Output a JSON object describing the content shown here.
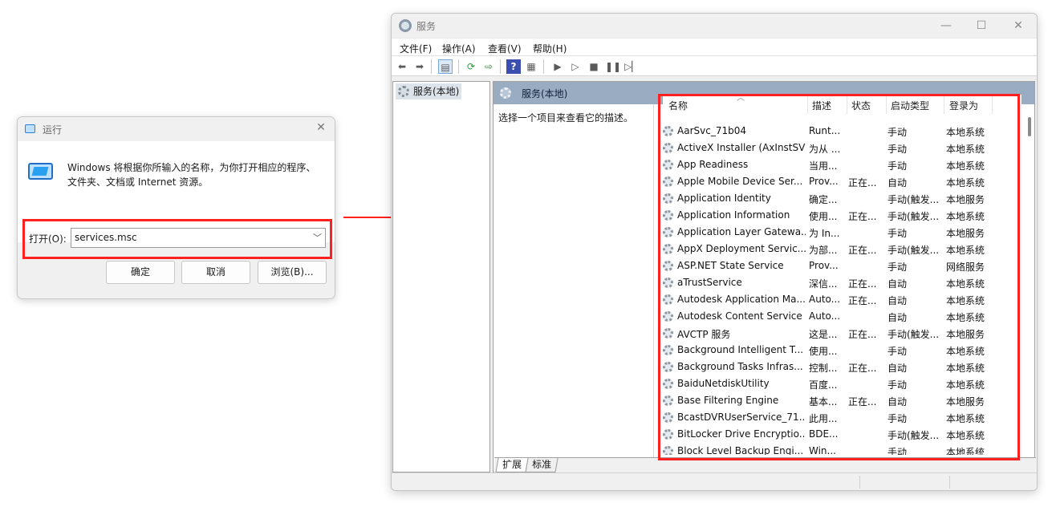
{
  "run_dialog": {
    "title": "运行",
    "description": "Windows 将根据你所输入的名称，为你打开相应的程序、文件夹、文档或 Internet 资源。",
    "open_label": "打开(O):",
    "open_value": "services.msc",
    "ok_label": "确定",
    "cancel_label": "取消",
    "browse_label": "浏览(B)..."
  },
  "services_window": {
    "title": "服务",
    "menu": [
      "文件(F)",
      "操作(A)",
      "查看(V)",
      "帮助(H)"
    ],
    "tree_item": "服务(本地)",
    "pane_header": "服务(本地)",
    "pane_description": "选择一个项目来查看它的描述。",
    "tabs": [
      "扩展",
      "标准"
    ],
    "columns": [
      "名称",
      "描述",
      "状态",
      "启动类型",
      "登录为"
    ],
    "services": [
      {
        "name": "AarSvc_71b04",
        "desc": "Runt...",
        "status": "",
        "startup": "手动",
        "logon": "本地系统"
      },
      {
        "name": "ActiveX Installer (AxInstSV)",
        "desc": "为从 ...",
        "status": "",
        "startup": "手动",
        "logon": "本地系统"
      },
      {
        "name": "App Readiness",
        "desc": "当用...",
        "status": "",
        "startup": "手动",
        "logon": "本地系统"
      },
      {
        "name": "Apple Mobile Device Ser...",
        "desc": "Prov...",
        "status": "正在...",
        "startup": "自动",
        "logon": "本地系统"
      },
      {
        "name": "Application Identity",
        "desc": "确定...",
        "status": "",
        "startup": "手动(触发...",
        "logon": "本地服务"
      },
      {
        "name": "Application Information",
        "desc": "使用...",
        "status": "正在...",
        "startup": "手动(触发...",
        "logon": "本地系统"
      },
      {
        "name": "Application Layer Gatewa...",
        "desc": "为 In...",
        "status": "",
        "startup": "手动",
        "logon": "本地服务"
      },
      {
        "name": "AppX Deployment Servic...",
        "desc": "为部...",
        "status": "正在...",
        "startup": "手动(触发...",
        "logon": "本地系统"
      },
      {
        "name": "ASP.NET State Service",
        "desc": "Prov...",
        "status": "",
        "startup": "手动",
        "logon": "网络服务"
      },
      {
        "name": "aTrustService",
        "desc": "深信...",
        "status": "正在...",
        "startup": "自动",
        "logon": "本地系统"
      },
      {
        "name": "Autodesk Application Ma...",
        "desc": "Auto...",
        "status": "正在...",
        "startup": "自动",
        "logon": "本地系统"
      },
      {
        "name": "Autodesk Content Service",
        "desc": "Auto...",
        "status": "",
        "startup": "自动",
        "logon": "本地系统"
      },
      {
        "name": "AVCTP 服务",
        "desc": "这是...",
        "status": "正在...",
        "startup": "手动(触发...",
        "logon": "本地服务"
      },
      {
        "name": "Background Intelligent T...",
        "desc": "使用...",
        "status": "",
        "startup": "手动",
        "logon": "本地系统"
      },
      {
        "name": "Background Tasks Infras...",
        "desc": "控制...",
        "status": "正在...",
        "startup": "自动",
        "logon": "本地系统"
      },
      {
        "name": "BaiduNetdiskUtility",
        "desc": "百度...",
        "status": "",
        "startup": "手动",
        "logon": "本地系统"
      },
      {
        "name": "Base Filtering Engine",
        "desc": "基本...",
        "status": "正在...",
        "startup": "自动",
        "logon": "本地服务"
      },
      {
        "name": "BcastDVRUserService_71...",
        "desc": "此用...",
        "status": "",
        "startup": "手动",
        "logon": "本地系统"
      },
      {
        "name": "BitLocker Drive Encryptio...",
        "desc": "BDE...",
        "status": "",
        "startup": "手动(触发...",
        "logon": "本地系统"
      },
      {
        "name": "Block Level Backup Engi...",
        "desc": "Win...",
        "status": "",
        "startup": "手动",
        "logon": "本地系统"
      }
    ]
  }
}
